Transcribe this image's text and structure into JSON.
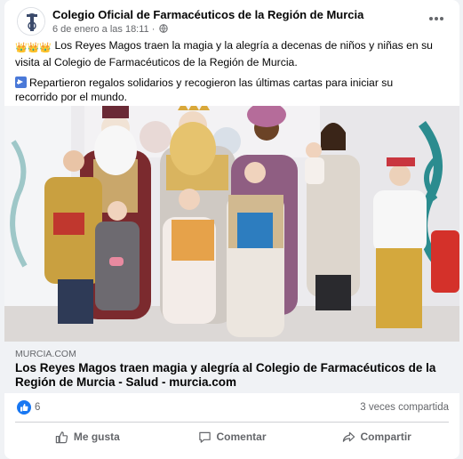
{
  "post": {
    "page_name": "Colegio Oficial de Farmacéuticos de la Región de Murcia",
    "date": "6 de enero a las 18:11",
    "separator": "·",
    "paragraph1": "Los Reyes Magos traen la magia y la alegría a decenas de niños y niñas en su visita al Colegio de Farmacéuticos de la Región de Murcia.",
    "paragraph2": "Repartieron regalos solidarios y recogieron las últimas cartas para iniciar su recorrido por el mundo.",
    "leading_emoji": "👑👑👑",
    "arrow_icon": "right-arrow-emoji-icon"
  },
  "link_preview": {
    "domain": "MURCIA.COM",
    "title": "Los Reyes Magos traen magia y alegría al Colegio de Farmacéuticos de la Región de Murcia - Salud - murcia.com"
  },
  "stats": {
    "likes": "6",
    "shares": "3 veces compartida"
  },
  "actions": {
    "like": "Me gusta",
    "comment": "Comentar",
    "share": "Compartir"
  },
  "colors": {
    "accent": "#1877f2",
    "secondary_text": "#65676b",
    "link_box_bg": "#f0f2f5"
  }
}
